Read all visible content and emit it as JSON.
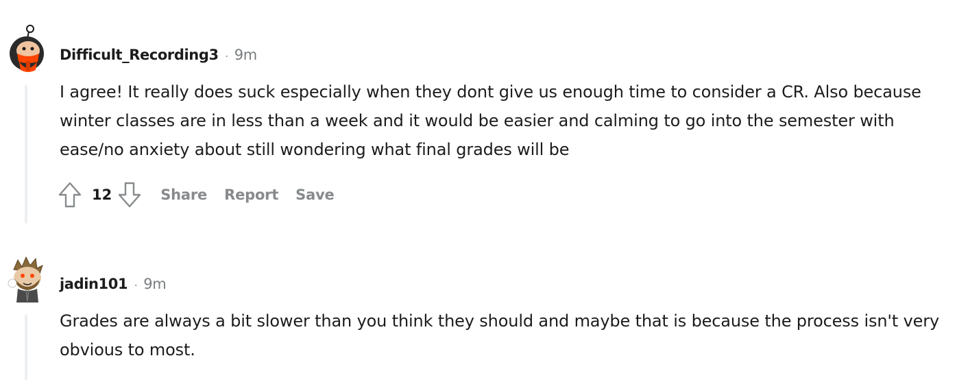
{
  "comments": [
    {
      "username": "Difficult_Recording3",
      "separator": "·",
      "time": "9m",
      "body": "I agree! It really does suck especially when they dont give us enough time to consider a CR. Also because winter classes are in less than a week and it would be easier and calming to go into the semester with ease/no anxiety about still wondering what final grades will be",
      "votes": "12",
      "actions": {
        "share": "Share",
        "report": "Report",
        "save": "Save"
      },
      "avatar_icon": "snoo-avatar-red-scarf-icon"
    },
    {
      "username": "jadin101",
      "separator": "·",
      "time": "9m",
      "body": "Grades are always a bit slower than you think they should and maybe that is because the process isn't very obvious to most.",
      "avatar_icon": "snoo-avatar-bearded-icon"
    }
  ],
  "colors": {
    "thread_line": "#edeff1",
    "action_gray": "#878a8c",
    "text": "#1c1c1c"
  }
}
